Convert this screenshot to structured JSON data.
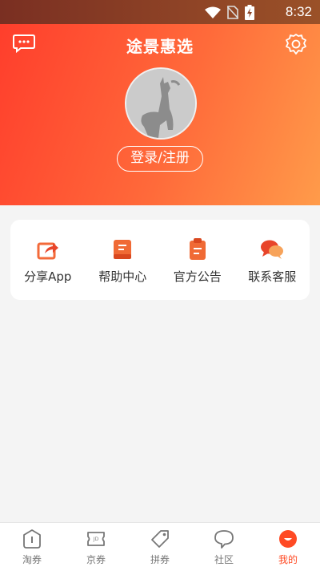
{
  "status": {
    "time": "8:32"
  },
  "header": {
    "title": "途景惠选",
    "login_label": "登录/注册"
  },
  "menu": [
    {
      "label": "分享App",
      "icon": "share-icon"
    },
    {
      "label": "帮助中心",
      "icon": "book-icon"
    },
    {
      "label": "官方公告",
      "icon": "clipboard-icon"
    },
    {
      "label": "联系客服",
      "icon": "chat-bubbles-icon"
    }
  ],
  "tabs": [
    {
      "label": "淘券",
      "icon": "tao-coupon-icon"
    },
    {
      "label": "京券",
      "icon": "jd-coupon-icon"
    },
    {
      "label": "拼券",
      "icon": "tag-icon"
    },
    {
      "label": "社区",
      "icon": "speech-bubble-icon"
    },
    {
      "label": "我的",
      "icon": "profile-icon",
      "active": true
    }
  ],
  "colors": {
    "accent": "#ff4a24",
    "header_start": "#ff3e2c",
    "header_end": "#ff9b4a"
  }
}
